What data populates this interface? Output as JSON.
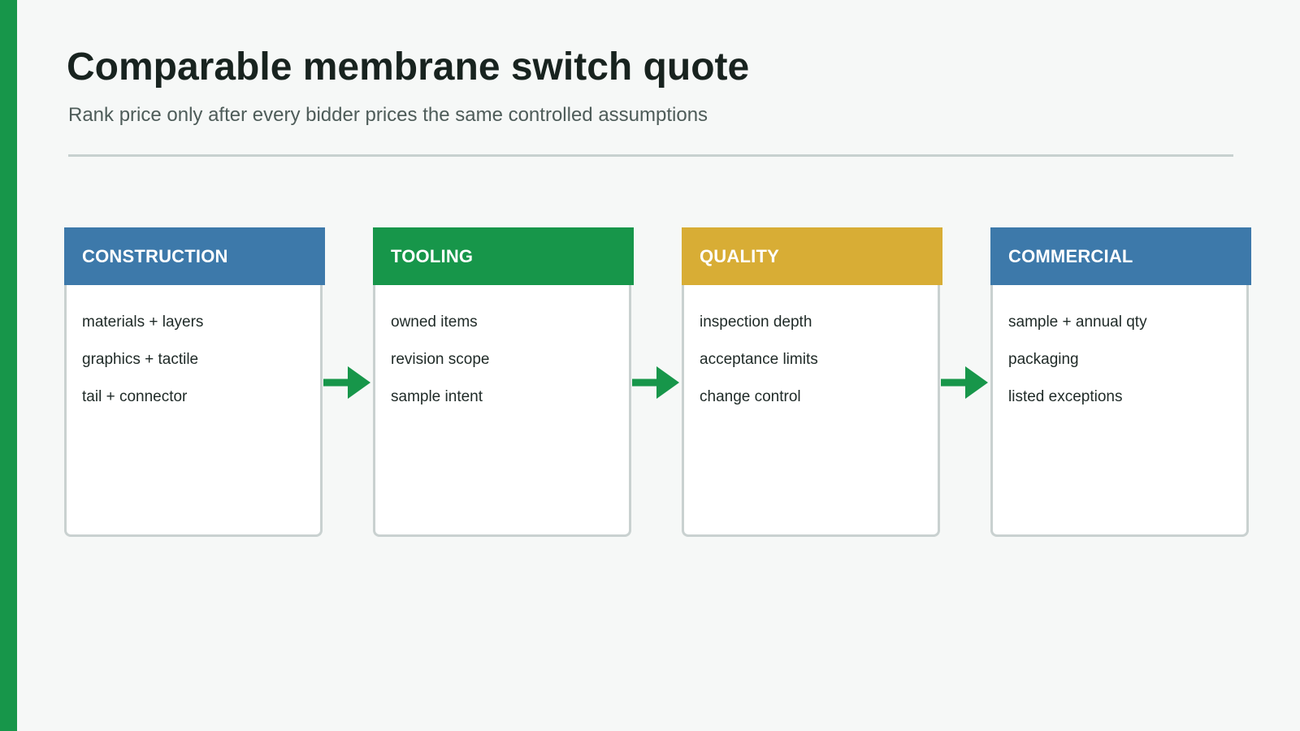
{
  "title": "Comparable membrane switch quote",
  "subtitle": "Rank price only after every bidder prices the same controlled assumptions",
  "colors": {
    "accent": "#17964a",
    "blue": "#3d79aa",
    "green": "#17964a",
    "gold": "#d8ad35",
    "arrow": "#17964a"
  },
  "cards": [
    {
      "header": "CONSTRUCTION",
      "color": "#3d79aa",
      "items": [
        "materials + layers",
        "graphics + tactile",
        "tail + connector"
      ]
    },
    {
      "header": "TOOLING",
      "color": "#17964a",
      "items": [
        "owned items",
        "revision scope",
        "sample intent"
      ]
    },
    {
      "header": "QUALITY",
      "color": "#d8ad35",
      "items": [
        "inspection depth",
        "acceptance limits",
        "change control"
      ]
    },
    {
      "header": "COMMERCIAL",
      "color": "#3d79aa",
      "items": [
        "sample + annual qty",
        "packaging",
        "listed exceptions"
      ]
    }
  ]
}
